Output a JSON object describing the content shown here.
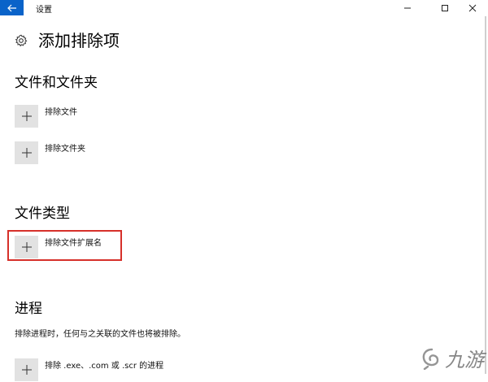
{
  "window": {
    "title": "设置",
    "icons": {
      "back": "back-arrow-icon",
      "minimize": "minimize-icon",
      "maximize": "maximize-icon",
      "close": "close-icon"
    }
  },
  "page": {
    "title": "添加排除项",
    "icon": "gear-icon"
  },
  "sections": {
    "files": {
      "title": "文件和文件夹",
      "items": [
        {
          "label": "排除文件"
        },
        {
          "label": "排除文件夹"
        }
      ]
    },
    "types": {
      "title": "文件类型",
      "items": [
        {
          "label": "排除文件扩展名"
        }
      ]
    },
    "process": {
      "title": "进程",
      "description": "排除进程时，任何与之关联的文件也将被排除。",
      "items": [
        {
          "label": "排除 .exe、.com 或 .scr 的进程"
        }
      ]
    }
  },
  "highlight": {
    "color": "#d6302a",
    "target": "排除文件扩展名"
  },
  "watermark": {
    "text": "九游",
    "icon": "swirl-logo-icon"
  },
  "colors": {
    "accent": "#0a63c9",
    "button_bg": "#e2e2e2"
  }
}
